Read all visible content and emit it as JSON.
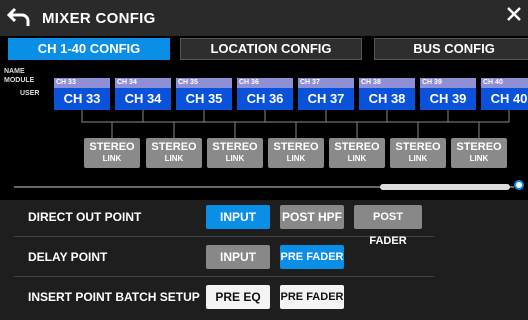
{
  "title": "MIXER CONFIG",
  "tabs": [
    {
      "label": "CH 1-40 CONFIG",
      "active": true
    },
    {
      "label": "LOCATION CONFIG",
      "active": false
    },
    {
      "label": "BUS CONFIG",
      "active": false
    }
  ],
  "row_labels": {
    "name": "NAME",
    "module": "MODULE",
    "user": "USER"
  },
  "channels": [
    {
      "module": "CH 33",
      "user": "CH 33"
    },
    {
      "module": "CH 34",
      "user": "CH 34"
    },
    {
      "module": "CH 35",
      "user": "CH 35"
    },
    {
      "module": "CH 36",
      "user": "CH 36"
    },
    {
      "module": "CH 37",
      "user": "CH 37"
    },
    {
      "module": "CH 38",
      "user": "CH 38"
    },
    {
      "module": "CH 39",
      "user": "CH 39"
    },
    {
      "module": "CH 40",
      "user": "CH 40"
    }
  ],
  "stereo_link": {
    "line1": "STEREO",
    "line2": "LINK"
  },
  "settings": {
    "direct_out": {
      "label": "DIRECT OUT POINT",
      "options": [
        "INPUT",
        "POST HPF",
        "POST FADER"
      ],
      "selected": "INPUT"
    },
    "delay": {
      "label": "DELAY POINT",
      "options": [
        "INPUT",
        "PRE FADER"
      ],
      "selected": "PRE FADER"
    },
    "insert": {
      "label": "INSERT POINT BATCH SETUP",
      "options": [
        "PRE EQ",
        "PRE FADER"
      ]
    }
  },
  "colors": {
    "accent": "#0a8ee6",
    "module": "#8f8fd6",
    "user": "#0a52d9"
  }
}
